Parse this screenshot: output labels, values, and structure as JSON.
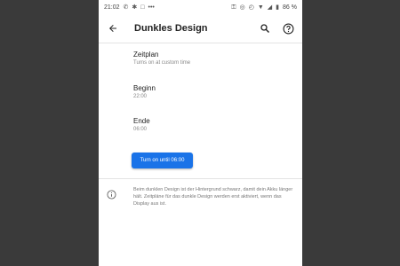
{
  "status_bar": {
    "time": "21:02",
    "notif_icons": [
      "phone-icon",
      "bluetooth-icon",
      "chat-icon"
    ],
    "more": "•••",
    "right_icons": [
      "key-icon",
      "location-icon",
      "alarm-icon",
      "wifi-icon",
      "signal-icon"
    ],
    "battery": "86 %"
  },
  "app_bar": {
    "title": "Dunkles Design",
    "back_icon": "arrow-back-icon",
    "search_icon": "search-icon",
    "help_icon": "help-icon"
  },
  "settings": [
    {
      "title": "Zeitplan",
      "subtitle": "Turns on at custom time"
    },
    {
      "title": "Beginn",
      "subtitle": "22:00"
    },
    {
      "title": "Ende",
      "subtitle": "06:00"
    }
  ],
  "action_button": {
    "label": "Turn on until 06:00"
  },
  "info": {
    "icon": "info-icon",
    "text": "Beim dunklen Design ist der Hintergrund schwarz, damit dein Akku länger hält. Zeitpläne für das dunkle Design werden erst aktiviert, wenn das Display aus ist."
  },
  "colors": {
    "accent": "#1a73e8",
    "background": "#ffffff",
    "outside": "#3a3a3a"
  }
}
